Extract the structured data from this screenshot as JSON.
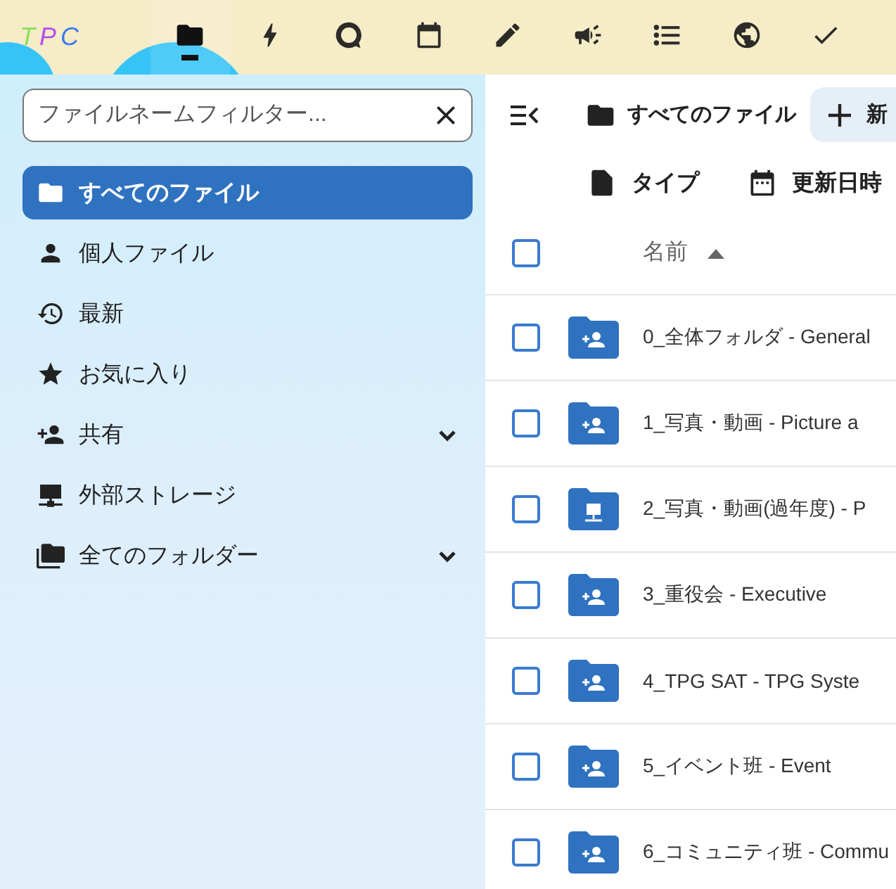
{
  "header": {
    "logo_text": "TPC",
    "apps": [
      {
        "kind": "folder",
        "selected": true
      },
      {
        "kind": "bolt",
        "selected": false
      },
      {
        "kind": "talk",
        "selected": false
      },
      {
        "kind": "calendar",
        "selected": false
      },
      {
        "kind": "pencil",
        "selected": false
      },
      {
        "kind": "megaphone",
        "selected": false
      },
      {
        "kind": "list",
        "selected": false
      },
      {
        "kind": "globe",
        "selected": false
      },
      {
        "kind": "check",
        "selected": false
      }
    ]
  },
  "sidebar": {
    "filter": {
      "placeholder": "ファイルネームフィルター..."
    },
    "items": [
      {
        "kind": "folder",
        "label": "すべてのファイル",
        "selected": true,
        "collapsible": false
      },
      {
        "kind": "person",
        "label": "個人ファイル",
        "selected": false,
        "collapsible": false
      },
      {
        "kind": "history",
        "label": "最新",
        "selected": false,
        "collapsible": false
      },
      {
        "kind": "star",
        "label": "お気に入り",
        "selected": false,
        "collapsible": false
      },
      {
        "kind": "share",
        "label": "共有",
        "selected": false,
        "collapsible": true
      },
      {
        "kind": "network",
        "label": "外部ストレージ",
        "selected": false,
        "collapsible": false
      },
      {
        "kind": "folders",
        "label": "全てのフォルダー",
        "selected": false,
        "collapsible": true
      }
    ]
  },
  "toolbar": {
    "breadcrumb": "すべてのファイル",
    "new_button": "新"
  },
  "filters": [
    {
      "kind": "type",
      "label": "タイプ"
    },
    {
      "kind": "date",
      "label": "更新日時"
    }
  ],
  "table": {
    "name_column": "名前",
    "select_all_checked": false,
    "rows": [
      {
        "kind": "shared",
        "name": "0_全体フォルダ - General",
        "checked": false
      },
      {
        "kind": "shared",
        "name": "1_写真・動画 - Picture a",
        "checked": false
      },
      {
        "kind": "external",
        "name": "2_写真・動画(過年度) - P",
        "checked": false
      },
      {
        "kind": "shared",
        "name": "3_重役会 - Executive",
        "checked": false
      },
      {
        "kind": "shared",
        "name": "4_TPG SAT - TPG Syste",
        "checked": false
      },
      {
        "kind": "shared",
        "name": "5_イベント班 - Event",
        "checked": false
      },
      {
        "kind": "shared",
        "name": "6_コミュニティ班 - Commu",
        "checked": false
      }
    ]
  }
}
